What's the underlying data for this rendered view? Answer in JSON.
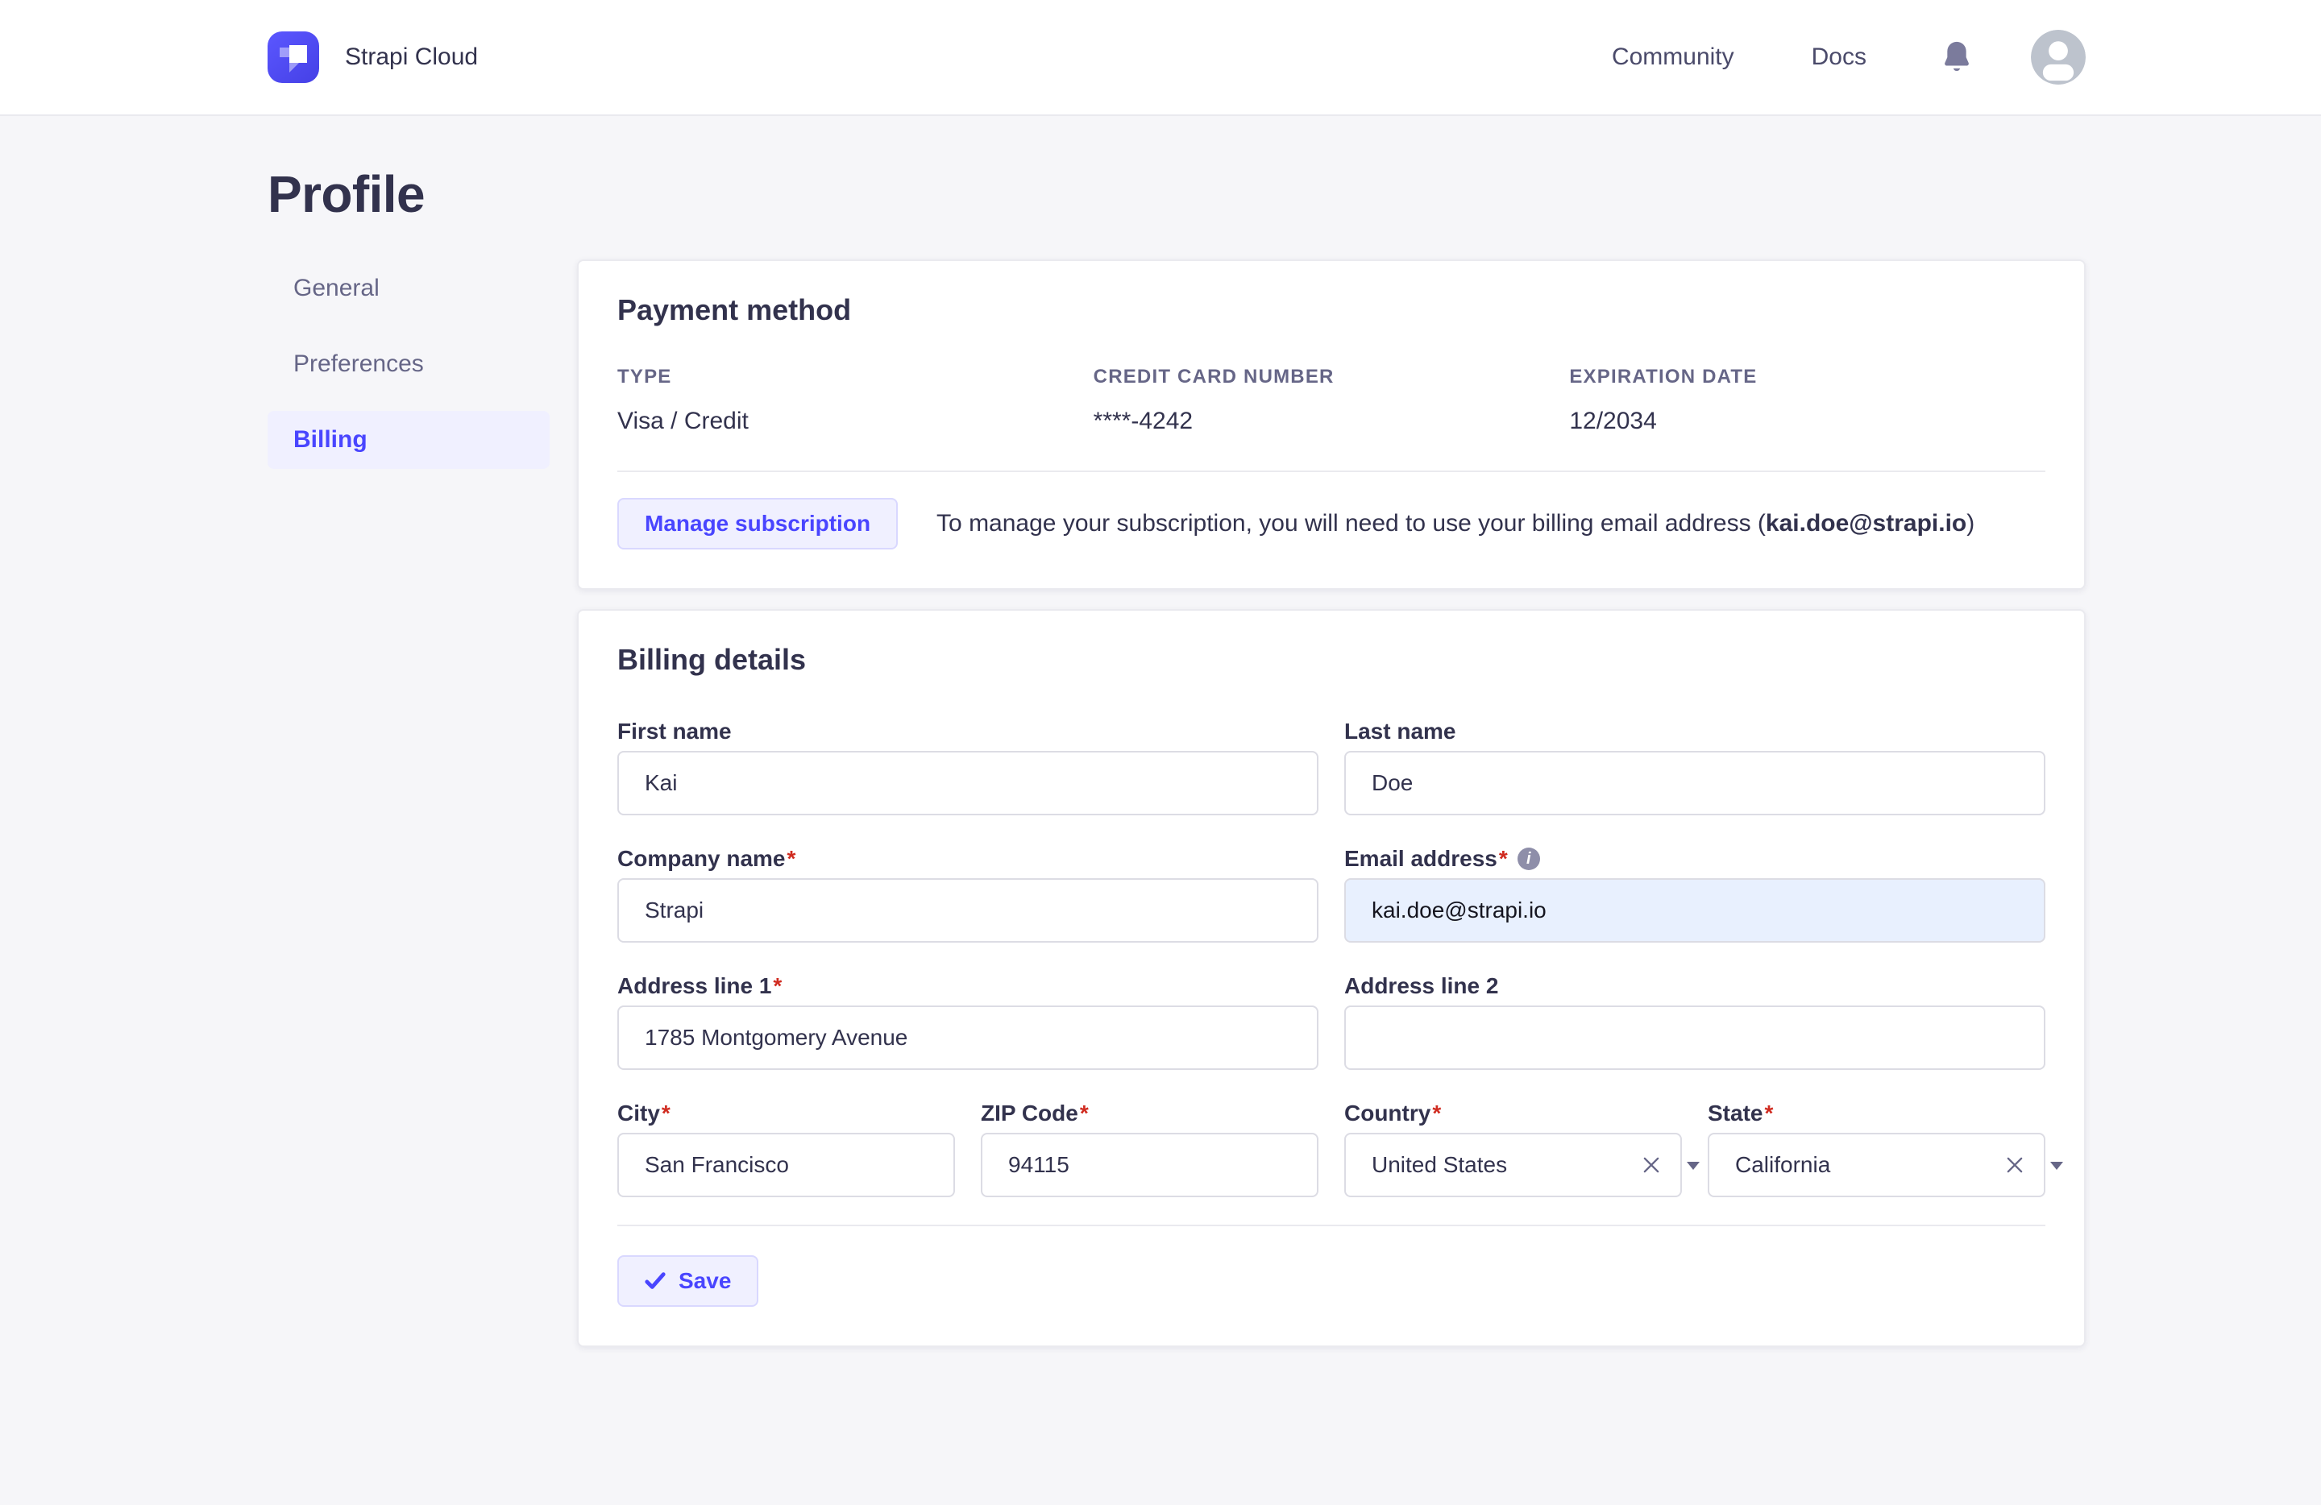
{
  "header": {
    "brand": "Strapi Cloud",
    "nav": {
      "community": "Community",
      "docs": "Docs"
    }
  },
  "page": {
    "title": "Profile"
  },
  "sidebar": {
    "items": [
      {
        "label": "General"
      },
      {
        "label": "Preferences"
      },
      {
        "label": "Billing"
      }
    ]
  },
  "payment": {
    "title": "Payment method",
    "fields": [
      {
        "label": "TYPE",
        "value": "Visa / Credit"
      },
      {
        "label": "CREDIT CARD NUMBER",
        "value": "****-4242"
      },
      {
        "label": "EXPIRATION DATE",
        "value": "12/2034"
      }
    ],
    "manage_button": "Manage subscription",
    "note_prefix": "To manage your subscription, you will need to use your billing email address (",
    "note_email": "kai.doe@strapi.io",
    "note_suffix": ")"
  },
  "billing": {
    "title": "Billing details",
    "first_name": {
      "label": "First name",
      "value": "Kai"
    },
    "last_name": {
      "label": "Last name",
      "value": "Doe"
    },
    "company": {
      "label": "Company name",
      "value": "Strapi"
    },
    "email": {
      "label": "Email address",
      "value": "kai.doe@strapi.io"
    },
    "address1": {
      "label": "Address line 1",
      "value": "1785 Montgomery Avenue"
    },
    "address2": {
      "label": "Address line 2",
      "value": ""
    },
    "city": {
      "label": "City",
      "value": "San Francisco"
    },
    "zip": {
      "label": "ZIP Code",
      "value": "94115"
    },
    "country": {
      "label": "Country",
      "value": "United States"
    },
    "state": {
      "label": "State",
      "value": "California"
    },
    "save_button": "Save",
    "info_icon_glyph": "i"
  },
  "ui": {
    "required_mark": "*"
  },
  "colors": {
    "primary": "#4945FF",
    "primary_bg": "#F0F0FF",
    "primary_border": "#D9D8FF",
    "text_dark": "#32324D",
    "text_muted": "#666687",
    "danger": "#D02B20",
    "email_filled_bg": "#E8F0FE",
    "page_bg": "#F6F6F9",
    "card_border": "#EAEAEF",
    "input_border": "#DCDCE4"
  }
}
